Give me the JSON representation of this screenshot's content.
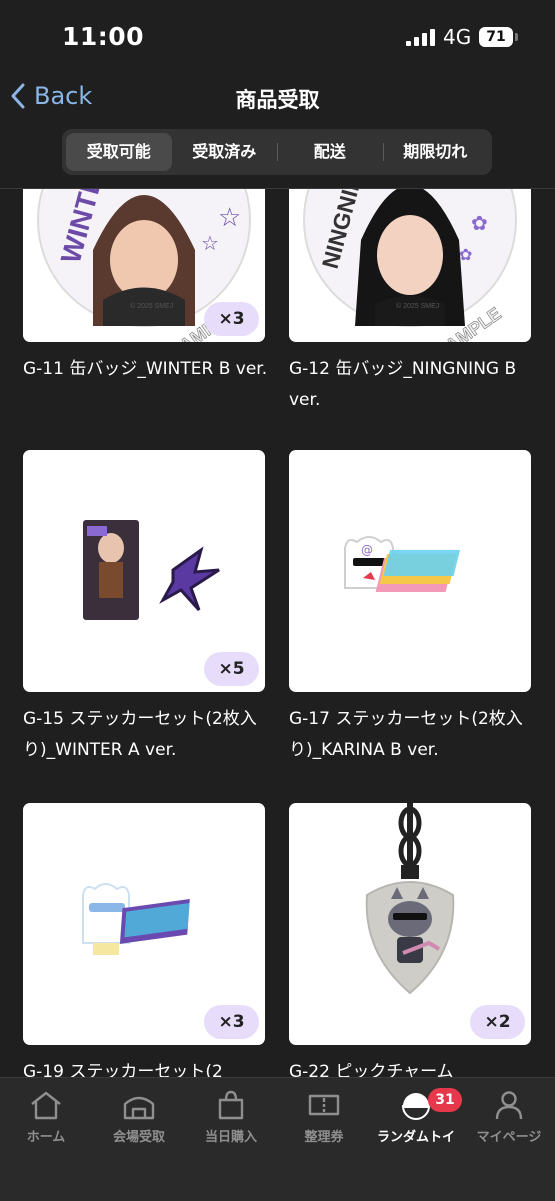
{
  "status_bar": {
    "time": "11:00",
    "network": "4G",
    "battery": "71"
  },
  "nav": {
    "back_label": "Back",
    "title": "商品受取"
  },
  "tabs": [
    "受取可能",
    "受取済み",
    "配送",
    "期限切れ"
  ],
  "items": [
    {
      "name": "G-11 缶バッジ_WINTER B ver.",
      "qty": "×3",
      "print_name": "WINTER",
      "watermark": "SAMPLE",
      "copyright": "© 2025 SMEJ"
    },
    {
      "name": "G-12 缶バッジ_NINGNING B ver.",
      "qty": "",
      "print_name": "NINGNING",
      "watermark": "SAMPLE",
      "copyright": "© 2025 SMEJ"
    },
    {
      "name": "G-15 ステッカーセット(2枚入り)_WINTER A ver.",
      "qty": "×5"
    },
    {
      "name": "G-17 ステッカーセット(2枚入り)_KARINA B ver.",
      "qty": ""
    },
    {
      "name": "G-19 ステッカーセット(2",
      "qty": "×3"
    },
    {
      "name": "G-22 ピックチャーム",
      "qty": "×2"
    }
  ],
  "bottom_nav": [
    {
      "label": "ホーム",
      "icon": "home-icon"
    },
    {
      "label": "会場受取",
      "icon": "venue-icon"
    },
    {
      "label": "当日購入",
      "icon": "shopping-bag-icon"
    },
    {
      "label": "整理券",
      "icon": "ticket-icon"
    },
    {
      "label": "ランダムトイ",
      "icon": "capsule-icon",
      "badge": "31"
    },
    {
      "label": "マイページ",
      "icon": "person-icon"
    }
  ],
  "colors": {
    "background": "#1f1f1f",
    "accent": "#8ab6e8",
    "qty_pill": "#e8dcfb",
    "badge": "#e5394b"
  }
}
